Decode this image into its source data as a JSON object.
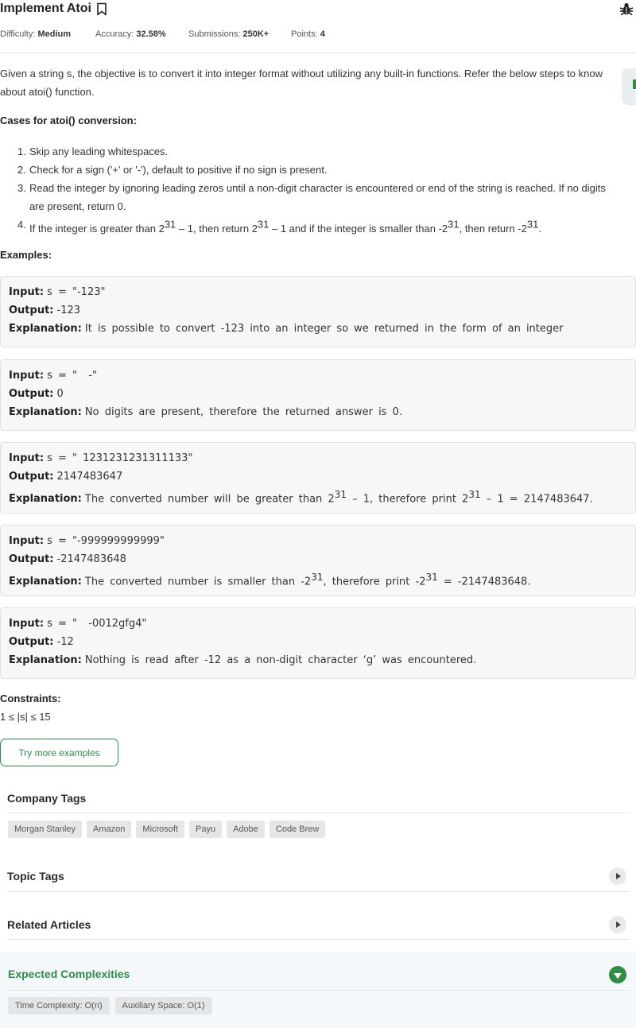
{
  "header": {
    "title": "Implement Atoi",
    "difficulty_label": "Difficulty:",
    "difficulty": "Medium",
    "accuracy_label": "Accuracy:",
    "accuracy": "32.58%",
    "submissions_label": "Submissions:",
    "submissions": "250K+",
    "points_label": "Points:",
    "points": "4"
  },
  "description": {
    "intro": "Given a string s, the objective is to convert it into integer format without utilizing any built-in functions. Refer the below steps to know about atoi() function.",
    "cases_heading": "Cases for atoi() conversion:",
    "steps": [
      {
        "num": "1.",
        "text": "Skip any leading whitespaces."
      },
      {
        "num": "2.",
        "text": "Check for a sign ('+' or '-'), default to positive if no sign is present."
      },
      {
        "num": "3.",
        "text": "Read the integer by ignoring leading zeros until a non-digit character is encountered or end of the string is reached. If no digits are present, return 0."
      },
      {
        "num": "4.",
        "a": "If the integer is greater than 2",
        "b": "31",
        "c": " – 1, then return 2",
        "d": "31",
        "e": " – 1 and if the integer is smaller than -2",
        "f": "31",
        "g": ", then return -2",
        "h": "31",
        "i": "."
      }
    ],
    "examples_heading": "Examples:"
  },
  "examples": [
    {
      "input_label": "Input:",
      "input": "s = \"-123\"",
      "output_label": "Output:",
      "output": "-123",
      "explanation_label": "Explanation:",
      "explanation": "It is possible to convert -123 into an integer so we returned in the form of an integer"
    },
    {
      "input_label": "Input:",
      "input": "s = \"  -\"",
      "output_label": "Output:",
      "output": "0",
      "explanation_label": "Explanation:",
      "explanation": "No digits are present, therefore the returned answer is 0."
    },
    {
      "input_label": "Input:",
      "input": "s = \" 1231231231311133\"",
      "output_label": "Output:",
      "output": "2147483647",
      "explanation_label": "Explanation:",
      "e1": "The converted number will be greater than 2",
      "e2": "31",
      "e3": " – 1, therefore print 2",
      "e4": "31",
      "e5": " – 1 = 2147483647."
    },
    {
      "input_label": "Input:",
      "input": "s = \"-999999999999\"",
      "output_label": "Output:",
      "output": "-2147483648",
      "explanation_label": "Explanation:",
      "e1": "The converted number is smaller than -2",
      "e2": "31",
      "e3": ", therefore print -2",
      "e4": "31",
      "e5": " = -2147483648."
    },
    {
      "input_label": "Input:",
      "input": "s = \"  -0012gfg4\"",
      "output_label": "Output:",
      "output": "-12",
      "explanation_label": "Explanation:",
      "explanation": "Nothing is read after -12 as a non-digit character ‘g’ was encountered."
    }
  ],
  "constraints": {
    "heading": "Constraints:",
    "text": "1 ≤ |s| ≤ 15"
  },
  "try_button": "Try more examples",
  "company_tags": {
    "title": "Company Tags",
    "tags": [
      "Morgan Stanley",
      "Amazon",
      "Microsoft",
      "Payu",
      "Adobe",
      "Code Brew"
    ]
  },
  "topic_tags": {
    "title": "Topic Tags"
  },
  "related_articles": {
    "title": "Related Articles"
  },
  "complexities": {
    "title": "Expected Complexities",
    "time": "Time Complexity: O(n)",
    "space": "Auxiliary Space: O(1)"
  },
  "colors": {
    "accent": "#2f8d46"
  }
}
